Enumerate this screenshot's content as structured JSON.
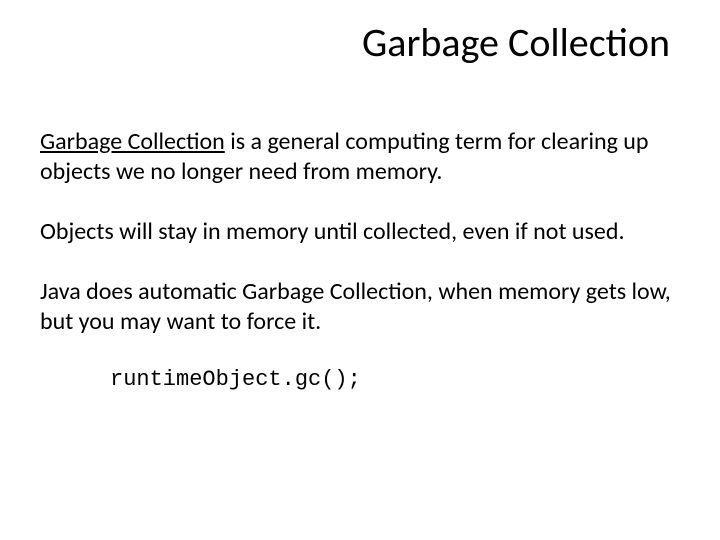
{
  "title": "Garbage Collection",
  "para1_underlined": "Garbage Collection",
  "para1_rest": " is a general computing term for clearing up objects we no longer need from memory.",
  "para2": "Objects will stay in memory until collected, even if not used.",
  "para3": "Java does automatic Garbage Collection, when memory gets low, but you may want to force it.",
  "code": "runtimeObject.gc();"
}
